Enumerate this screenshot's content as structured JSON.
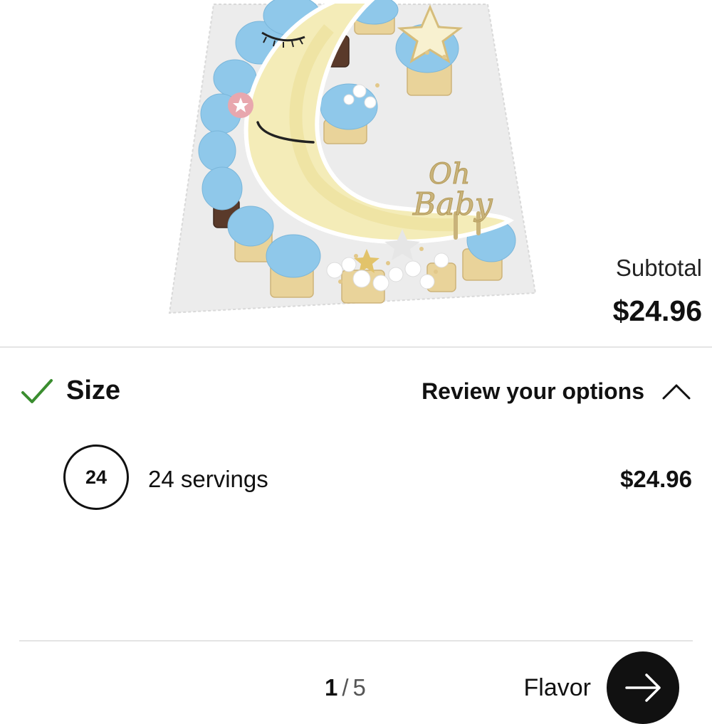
{
  "product_image": {
    "topper_text": [
      "Oh",
      "Baby"
    ]
  },
  "summary": {
    "subtotal_label": "Subtotal",
    "subtotal_value": "$24.96"
  },
  "size_section": {
    "title": "Size",
    "completed": true,
    "review_link": "Review your options",
    "option": {
      "badge": "24",
      "label": "24 servings",
      "price": "$24.96"
    }
  },
  "footer": {
    "page_current": "1",
    "page_separator": "/",
    "page_total": "5",
    "next_label": "Flavor"
  },
  "colors": {
    "check": "#3a8d2f",
    "frosting": "#8fc8ea",
    "moon": "#f4ecb8",
    "topper_gold": "#c9b37a",
    "board": "#eeeeee"
  }
}
